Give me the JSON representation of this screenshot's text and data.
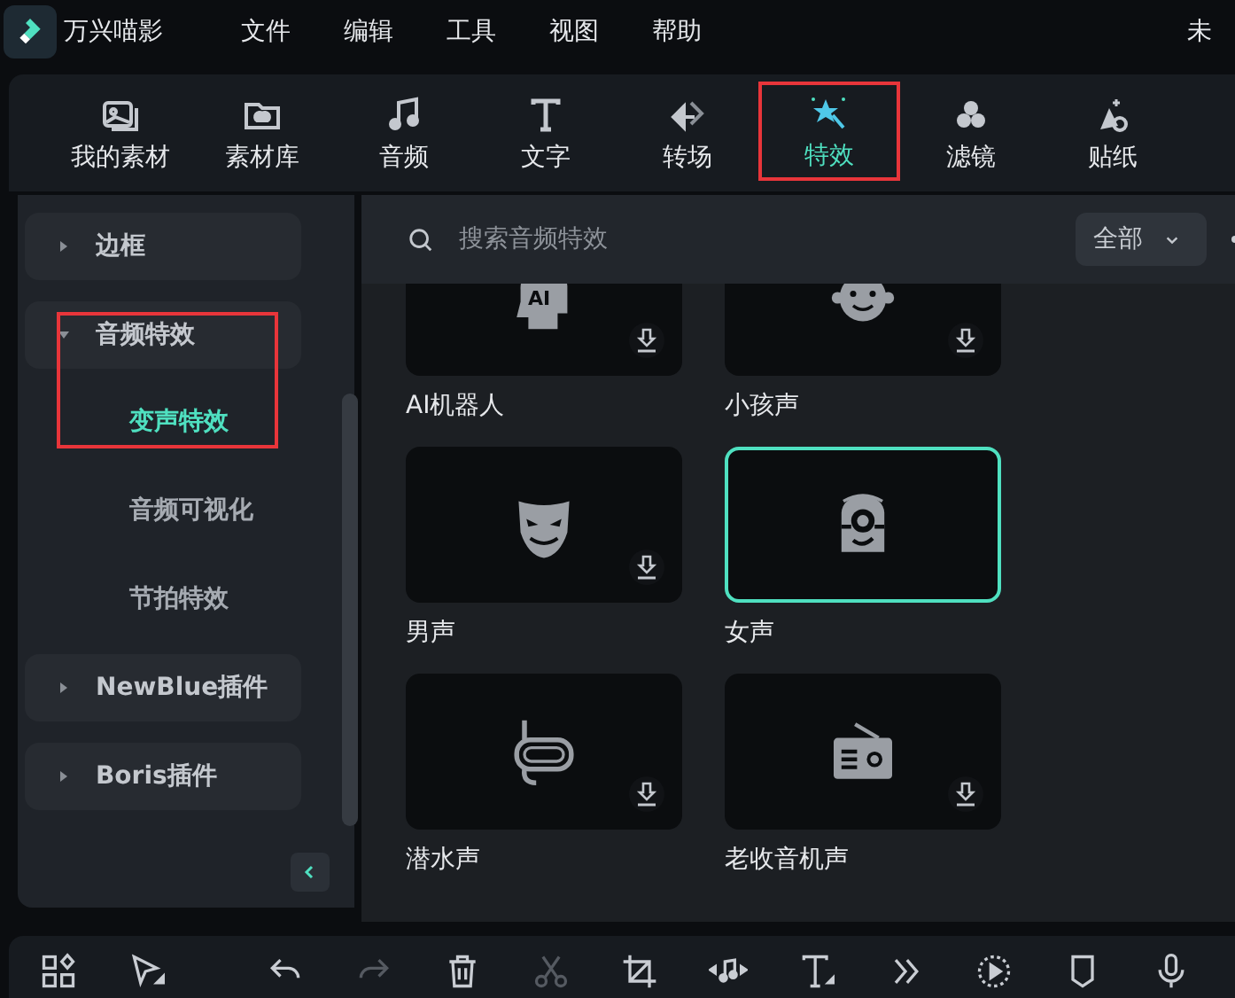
{
  "app": {
    "name": "万兴喵影",
    "document_title": "未"
  },
  "menu": [
    "文件",
    "编辑",
    "工具",
    "视图",
    "帮助"
  ],
  "tabs": [
    {
      "label": "我的素材",
      "selected": false,
      "highlighted": false
    },
    {
      "label": "素材库",
      "selected": false,
      "highlighted": false
    },
    {
      "label": "音频",
      "selected": false,
      "highlighted": false
    },
    {
      "label": "文字",
      "selected": false,
      "highlighted": false
    },
    {
      "label": "转场",
      "selected": false,
      "highlighted": false
    },
    {
      "label": "特效",
      "selected": true,
      "highlighted": true
    },
    {
      "label": "滤镜",
      "selected": false,
      "highlighted": false
    },
    {
      "label": "贴纸",
      "selected": false,
      "highlighted": false
    }
  ],
  "sidebar": {
    "items": [
      {
        "label": "边框",
        "expanded": false,
        "highlighted": false
      },
      {
        "label": "音频特效",
        "expanded": true,
        "highlighted": true,
        "children": [
          {
            "label": "变声特效",
            "selected": true
          },
          {
            "label": "音频可视化",
            "selected": false
          },
          {
            "label": "节拍特效",
            "selected": false
          }
        ]
      },
      {
        "label": "NewBlue插件",
        "expanded": false,
        "highlighted": false
      },
      {
        "label": "Boris插件",
        "expanded": false,
        "highlighted": false
      }
    ]
  },
  "search": {
    "placeholder": "搜索音频特效",
    "filter": "全部"
  },
  "effects": [
    {
      "label": "AI机器人",
      "badge": "AI",
      "selected": false,
      "downloadable": true
    },
    {
      "label": "小孩声",
      "selected": false,
      "downloadable": true
    },
    {
      "label": "男声",
      "selected": false,
      "downloadable": true
    },
    {
      "label": "女声",
      "selected": true,
      "downloadable": false
    },
    {
      "label": "潜水声",
      "selected": false,
      "downloadable": true
    },
    {
      "label": "老收音机声",
      "selected": false,
      "downloadable": true
    }
  ],
  "bottom_toolbar": [
    {
      "disabled": false
    },
    {
      "disabled": false
    },
    {
      "disabled": false
    },
    {
      "disabled": true
    },
    {
      "disabled": false
    },
    {
      "disabled": true
    },
    {
      "disabled": false
    },
    {
      "disabled": false
    },
    {
      "disabled": false
    },
    {
      "disabled": false
    },
    {
      "disabled": false
    },
    {
      "disabled": false
    },
    {
      "disabled": false
    }
  ]
}
